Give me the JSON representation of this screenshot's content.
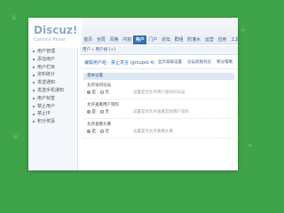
{
  "logo": {
    "main": "Discuz!",
    "sub": "Control Panel"
  },
  "topnav": [
    "首页",
    "全局",
    "风格",
    "内容",
    "用户",
    "门户",
    "论坛",
    "群组",
    "防灌水",
    "运营",
    "应用",
    "工具"
  ],
  "topnav_active": 4,
  "sidebar": [
    "用户管理",
    "添加用户",
    "用户栏目",
    "资料统计",
    "发送通知",
    "发送手机通知",
    "用户标签",
    "禁止用户",
    "禁止IP",
    "积分奖惩"
  ],
  "crumb": "用户 » 用户组 [+]",
  "title": "编辑用户组 - 禁止发言 (groupid 4)",
  "links": [
    "显示高级设置",
    "论坛权限对比",
    "积分策略"
  ],
  "section": "基本设置",
  "settings": [
    {
      "label": "允许访问论坛",
      "options": [
        "是",
        "否"
      ],
      "hint": "设置是否允许用户组访问论坛"
    },
    {
      "label": "允许查看用户资料",
      "options": [
        "是",
        "否"
      ],
      "hint": "设置是否允许查看其他用户资料"
    },
    {
      "label": "允许查看头像",
      "options": [
        "是",
        "否"
      ],
      "hint": "设置是否允许查看头像"
    }
  ]
}
